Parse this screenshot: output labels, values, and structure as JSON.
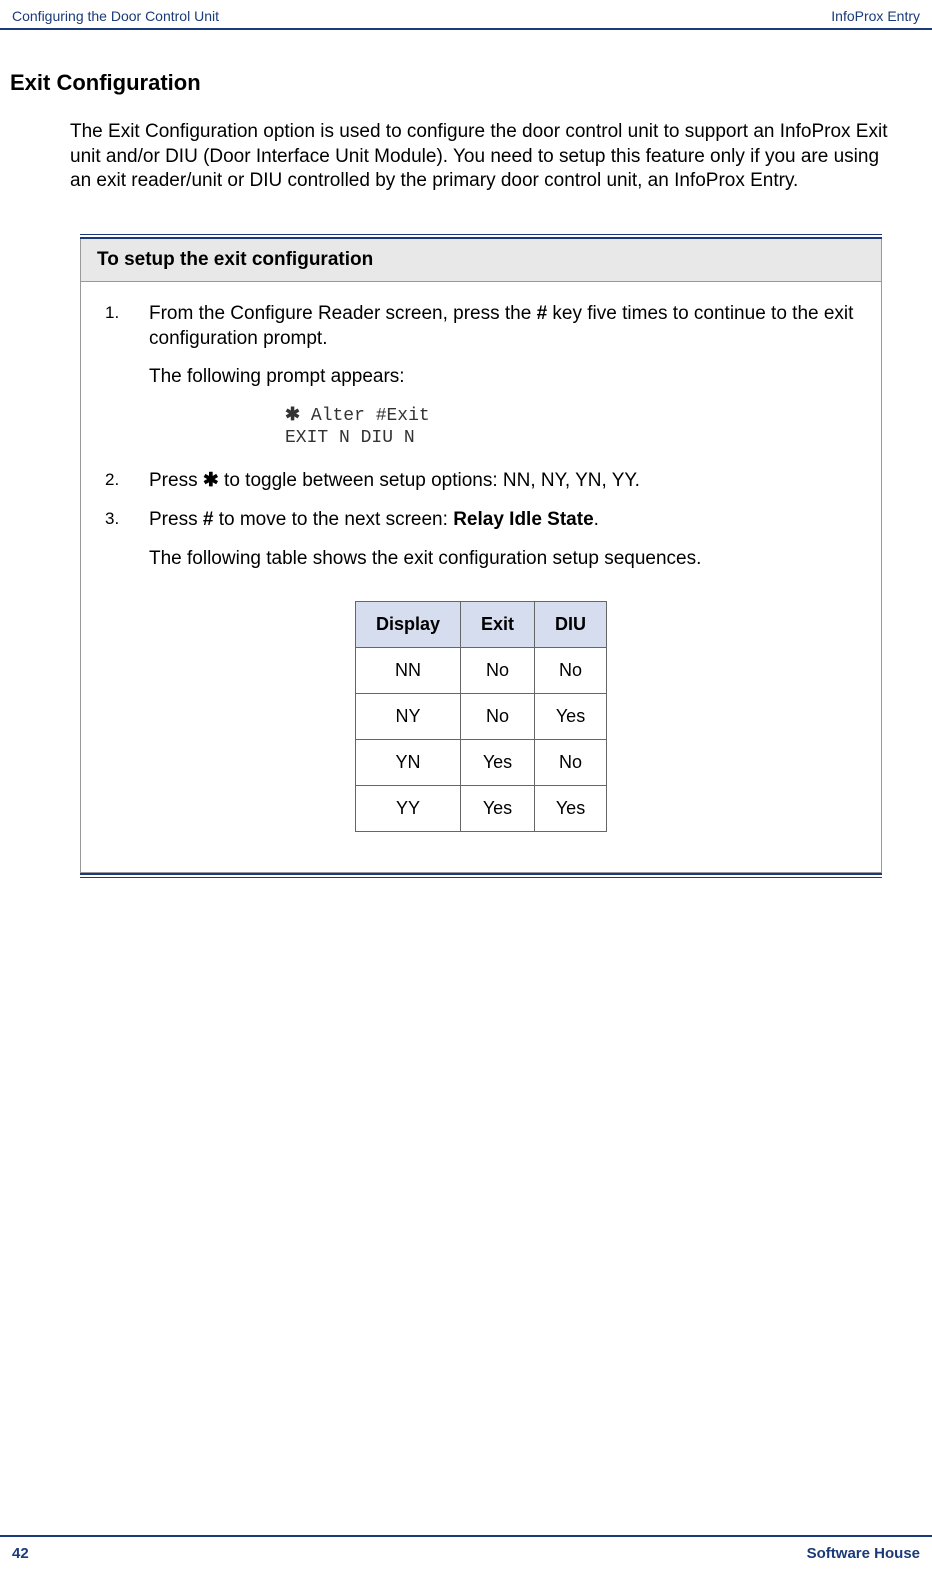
{
  "header": {
    "left": "Configuring the Door Control Unit",
    "right": "InfoProx Entry"
  },
  "heading": "Exit Configuration",
  "intro": "The Exit Configuration option is used to configure the door control unit to support an InfoProx Exit unit and/or DIU (Door Interface Unit Module). You need to setup this feature only if you are using an exit reader/unit or DIU controlled by the primary door control unit, an InfoProx Entry.",
  "box": {
    "title": "To setup the exit configuration",
    "step1": {
      "num": "1.",
      "text_before": "From the Configure Reader screen, press the ",
      "key": "#",
      "text_after": " key five times to continue to the exit configuration prompt."
    },
    "prompt_intro": "The following prompt appears:",
    "prompt_line1": " Alter  #Exit",
    "prompt_line2": "EXIT N  DIU N",
    "step2": {
      "num": "2.",
      "text_before": "Press ",
      "text_after": " to toggle between setup options: NN, NY, YN, YY."
    },
    "step3": {
      "num": "3.",
      "text_before": "Press ",
      "key": "#",
      "text_mid": " to move to the next screen: ",
      "bold": "Relay Idle State",
      "text_after": "."
    },
    "table_intro": "The following table shows the exit configuration setup sequences.",
    "table": {
      "headers": {
        "c1": "Display",
        "c2": "Exit",
        "c3": "DIU"
      },
      "rows": [
        {
          "c1": "NN",
          "c2": "No",
          "c3": "No"
        },
        {
          "c1": "NY",
          "c2": "No",
          "c3": "Yes"
        },
        {
          "c1": "YN",
          "c2": "Yes",
          "c3": "No"
        },
        {
          "c1": "YY",
          "c2": "Yes",
          "c3": "Yes"
        }
      ]
    }
  },
  "footer": {
    "left": "42",
    "right": "Software House"
  }
}
